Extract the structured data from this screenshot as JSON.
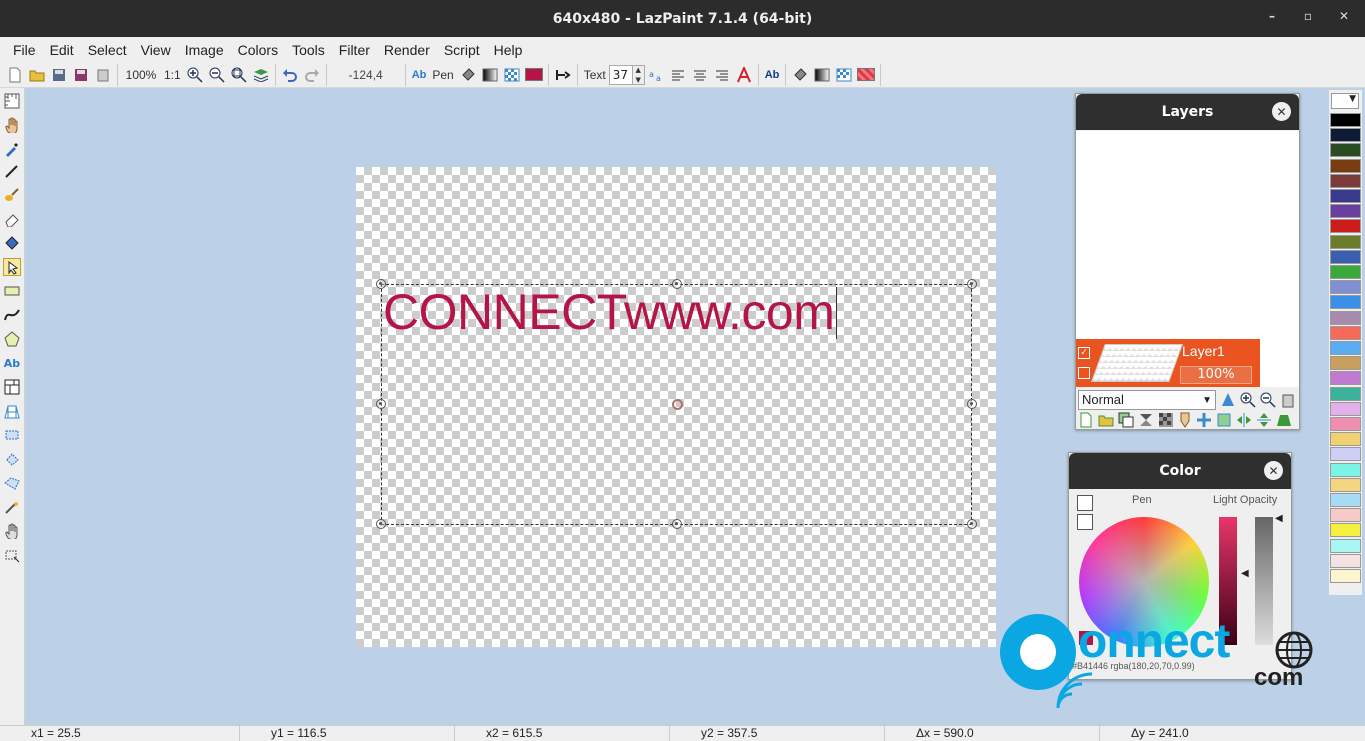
{
  "window": {
    "title": "640x480 - LazPaint 7.1.4 (64-bit)",
    "minimize": "–",
    "maximize": "▫",
    "close": "✕"
  },
  "menu": [
    "File",
    "Edit",
    "Select",
    "View",
    "Image",
    "Colors",
    "Tools",
    "Filter",
    "Render",
    "Script",
    "Help"
  ],
  "toolbar": {
    "zoom": "100%",
    "one_to_one": "1:1",
    "coords": "-124,4",
    "ab_label": "Ab",
    "pen_label": "Pen",
    "text_label": "Text",
    "font_size": "37",
    "bold_ab": "Ab",
    "pen_color": "#b41446",
    "back_color": "#e03a4a"
  },
  "canvas": {
    "text": "CONNECTwww.com",
    "text_color": "#b41446"
  },
  "layers_panel": {
    "title": "Layers",
    "layer_name": "Layer1",
    "layer_opacity": "100%",
    "blend_mode": "Normal",
    "selected_color": "#e95420"
  },
  "color_panel": {
    "title": "Color",
    "pen_label": "Pen",
    "light_opacity_label": "Light Opacity",
    "info": "#B41446  rgba(180,20,70,0.99)"
  },
  "palette": [
    "#000000",
    "#0d1b35",
    "#2b4b22",
    "#7a3d12",
    "#7c3b3b",
    "#3a3a8c",
    "#6b3fa0",
    "#cc1c1c",
    "#6b7d2b",
    "#3a5fb0",
    "#3aa83a",
    "#7f8fcf",
    "#3a8fe8",
    "#a78cae",
    "#f76a5b",
    "#5aabef",
    "#c7a060",
    "#c07bd0",
    "#3bb39a",
    "#e4b0e9",
    "#ef8fb0",
    "#f0d070",
    "#cfcff6",
    "#7cf4e6",
    "#f3d67f",
    "#a8dbf5",
    "#f7c9c9",
    "#f5ef3f",
    "#a8f7f4",
    "#f3e3e3",
    "#fbf5d0"
  ],
  "status": {
    "x1": "x1 = 25.5",
    "y1": "y1 = 116.5",
    "x2": "x2 = 615.5",
    "y2": "y2 = 357.5",
    "dx": "Δx = 590.0",
    "dy": "Δy = 241.0"
  },
  "watermark": {
    "brand": "onnect",
    "suffix": "com",
    "brand_color": "#0aa7e2"
  }
}
